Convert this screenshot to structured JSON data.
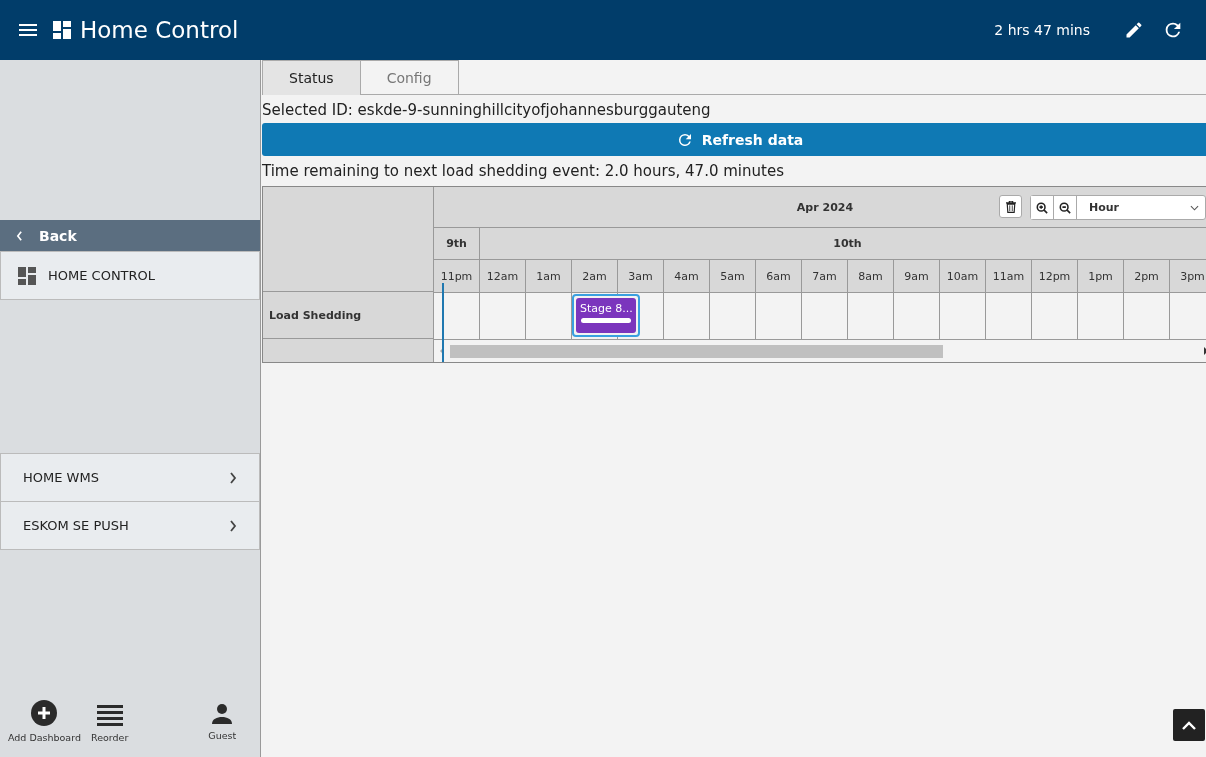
{
  "header": {
    "title": "Home Control",
    "countdown": "2 hrs 47 mins"
  },
  "sidebar": {
    "back": "Back",
    "current": "HOME CONTROL",
    "items": [
      {
        "label": "HOME WMS"
      },
      {
        "label": "ESKOM SE PUSH"
      }
    ],
    "footer": [
      {
        "kind": "add",
        "label": "Add Dashboard"
      },
      {
        "kind": "reorder",
        "label": "Reorder"
      },
      {
        "kind": "user",
        "label": "Guest"
      }
    ]
  },
  "tabs": [
    {
      "label": "Status",
      "selected": true
    },
    {
      "label": "Config",
      "selected": false
    }
  ],
  "selected_id": "Selected ID: eskde-9-sunninghillcityofjohannesburggauteng",
  "refresh_button": "Refresh data",
  "remaining": "Time remaining to next load shedding event: 2.0 hours, 47.0 minutes",
  "timeline": {
    "month": "Apr 2024",
    "scale": "Hour",
    "days": [
      {
        "label": "9th"
      },
      {
        "label": "10th"
      }
    ],
    "hours": [
      "11pm",
      "12am",
      "1am",
      "2am",
      "3am",
      "4am",
      "5am",
      "6am",
      "7am",
      "8am",
      "9am",
      "10am",
      "11am",
      "12pm",
      "1pm",
      "2pm",
      "3pm"
    ],
    "rows": [
      {
        "label": "Load Shedding",
        "events": [
          {
            "label": "Stage 8..."
          }
        ]
      }
    ]
  }
}
